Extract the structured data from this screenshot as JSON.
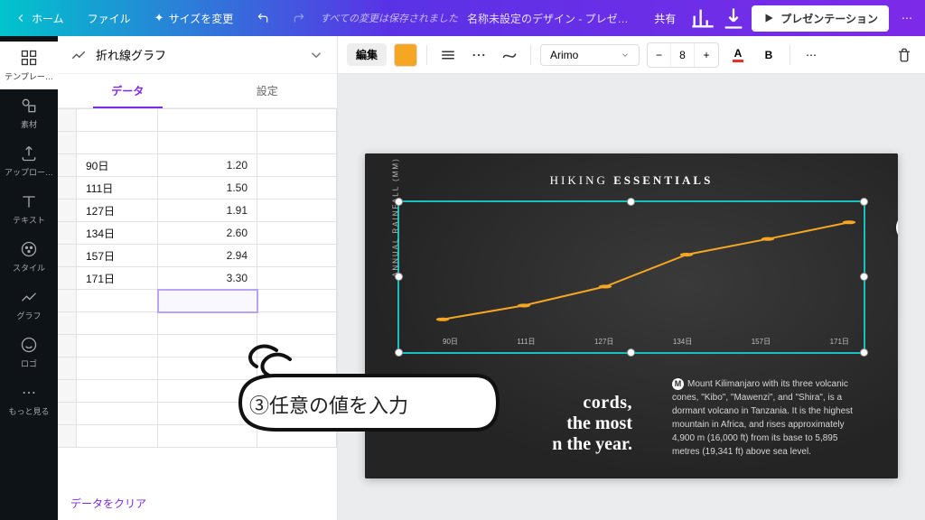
{
  "topbar": {
    "home": "ホーム",
    "file": "ファイル",
    "resize": "サイズを変更",
    "saved_msg": "すべての変更は保存されました",
    "doc_title": "名称未設定のデザイン - プレゼ…",
    "share": "共有",
    "present": "プレゼンテーション"
  },
  "rail": {
    "templates": "テンプレー…",
    "elements": "素材",
    "uploads": "アップロー…",
    "text": "テキスト",
    "style": "スタイル",
    "graph": "グラフ",
    "logo": "ロゴ",
    "more": "もっと見る"
  },
  "panel": {
    "header": "折れ線グラフ",
    "tab_data": "データ",
    "tab_settings": "設定",
    "clear": "データをクリア"
  },
  "chart_data": {
    "type": "line",
    "title": "HIKING ESSENTIALS",
    "ylabel": "ANNUAL RAINFALL (MM)",
    "categories": [
      "90日",
      "111日",
      "127日",
      "134日",
      "157日",
      "171日"
    ],
    "values": [
      1.2,
      1.5,
      1.91,
      2.6,
      2.94,
      3.3
    ],
    "ylim": [
      1.0,
      3.5
    ],
    "color": "#f5a623"
  },
  "toolbar": {
    "edit": "編集",
    "font": "Arimo",
    "font_size": "8",
    "text_color": "#e5322d",
    "bold": "B"
  },
  "slide": {
    "title_a": "HIKING ",
    "title_b": "ESSENTIALS",
    "caption1": "cords,",
    "caption2": "the most",
    "caption3": "n the year.",
    "desc": "Mount Kilimanjaro with its three volcanic cones, \"Kibo\", \"Mawenzi\", and \"Shira\", is a dormant volcano in Tanzania. It is the highest mountain in Africa, and rises approximately 4,900 m (16,000 ft) from its base to 5,895 metres (19,341 ft) above sea level.",
    "desc_badge": "M"
  },
  "annotation": {
    "bubble": "③任意の値を入力"
  }
}
